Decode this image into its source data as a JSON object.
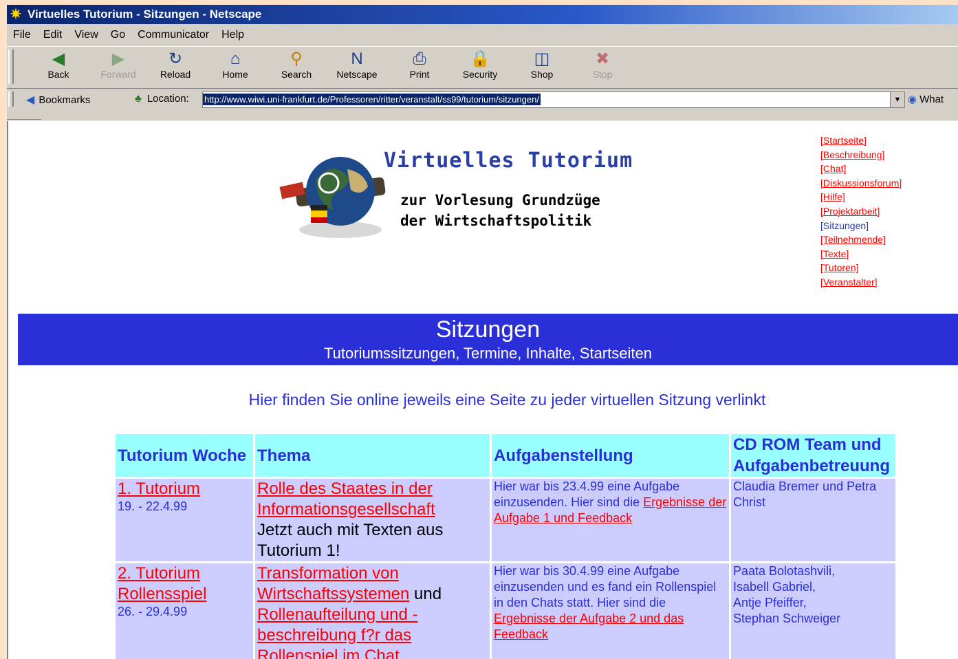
{
  "window": {
    "title": "Virtuelles Tutorium - Sitzungen - Netscape"
  },
  "menu": [
    "File",
    "Edit",
    "View",
    "Go",
    "Communicator",
    "Help"
  ],
  "toolbar": [
    {
      "label": "Back",
      "icon": "back-icon",
      "enabled": true
    },
    {
      "label": "Forward",
      "icon": "forward-icon",
      "enabled": false
    },
    {
      "label": "Reload",
      "icon": "reload-icon",
      "enabled": true
    },
    {
      "label": "Home",
      "icon": "home-icon",
      "enabled": true
    },
    {
      "label": "Search",
      "icon": "search-icon",
      "enabled": true
    },
    {
      "label": "Netscape",
      "icon": "netscape-icon",
      "enabled": true
    },
    {
      "label": "Print",
      "icon": "print-icon",
      "enabled": true
    },
    {
      "label": "Security",
      "icon": "security-icon",
      "enabled": true
    },
    {
      "label": "Shop",
      "icon": "shop-icon",
      "enabled": true
    },
    {
      "label": "Stop",
      "icon": "stop-icon",
      "enabled": false
    }
  ],
  "location": {
    "bookmarks_label": "Bookmarks",
    "location_label": "Location:",
    "url": "http://www.wiwi.uni-frankfurt.de/Professoren/ritter/veranstalt/ss99/tutorium/sitzungen/",
    "whats_related": "What"
  },
  "page": {
    "title": "Virtuelles Tutorium",
    "subtitle_line1": "zur Vorlesung Grundzüge",
    "subtitle_line2": "der Wirtschaftspolitik",
    "nav": [
      {
        "label": "[Startseite]",
        "current": false
      },
      {
        "label": "[Beschreibung]",
        "current": false
      },
      {
        "label": "[Chat]",
        "current": false
      },
      {
        "label": "[Diskussionsforum]",
        "current": false
      },
      {
        "label": "[Hilfe]",
        "current": false
      },
      {
        "label": "[Projektarbeit]",
        "current": false
      },
      {
        "label": "[Sitzungen]",
        "current": true
      },
      {
        "label": "[Teilnehmende]",
        "current": false
      },
      {
        "label": "[Texte]",
        "current": false
      },
      {
        "label": "[Tutoren]",
        "current": false
      },
      {
        "label": "[Veranstalter]",
        "current": false
      }
    ],
    "banner_title": "Sitzungen",
    "banner_subtitle": "Tutoriumssitzungen, Termine, Inhalte, Startseiten",
    "intro": "Hier finden Sie online jeweils eine Seite zu jeder virtuellen Sitzung verlinkt",
    "table": {
      "headers": [
        "Tutorium Woche",
        "Thema",
        "Aufgabenstellung",
        "CD ROM Team und Aufgabenbetreuung"
      ],
      "rows": [
        {
          "tutorium": "1. Tutorium",
          "tutorium_extra": "",
          "date": "19. - 22.4.99",
          "thema_links": [
            "Rolle des Staates in der Informationsgesellschaft"
          ],
          "thema_join": "",
          "thema_text": "Jetzt auch mit Texten aus Tutorium 1!",
          "aufg_text": "Hier war bis 23.4.99 eine Aufgabe einzusenden. Hier sind die ",
          "aufg_link": "Ergebnisse der Aufgabe 1 und Feedback",
          "team": "Claudia Bremer und Petra Christ"
        },
        {
          "tutorium": "2. Tutorium",
          "tutorium_extra": "Rollensspiel",
          "date": "26. - 29.4.99",
          "thema_links": [
            "Transformation von Wirtschaftssystemen",
            "Rollenaufteilung und -beschreibung f?r das Rollenspiel im Chat"
          ],
          "thema_join": " und ",
          "thema_text": "",
          "aufg_text": "Hier war bis 30.4.99 eine Aufgabe einzusenden und es fand ein Rollenspiel in den Chats statt. Hier sind die ",
          "aufg_link": "Ergebnisse der Aufgabe 2 und das Feedback",
          "team": "Paata Bolotashvili,\nIsabell Gabriel,\nAntje Pfeiffer,\nStephan Schweiger"
        }
      ]
    }
  }
}
